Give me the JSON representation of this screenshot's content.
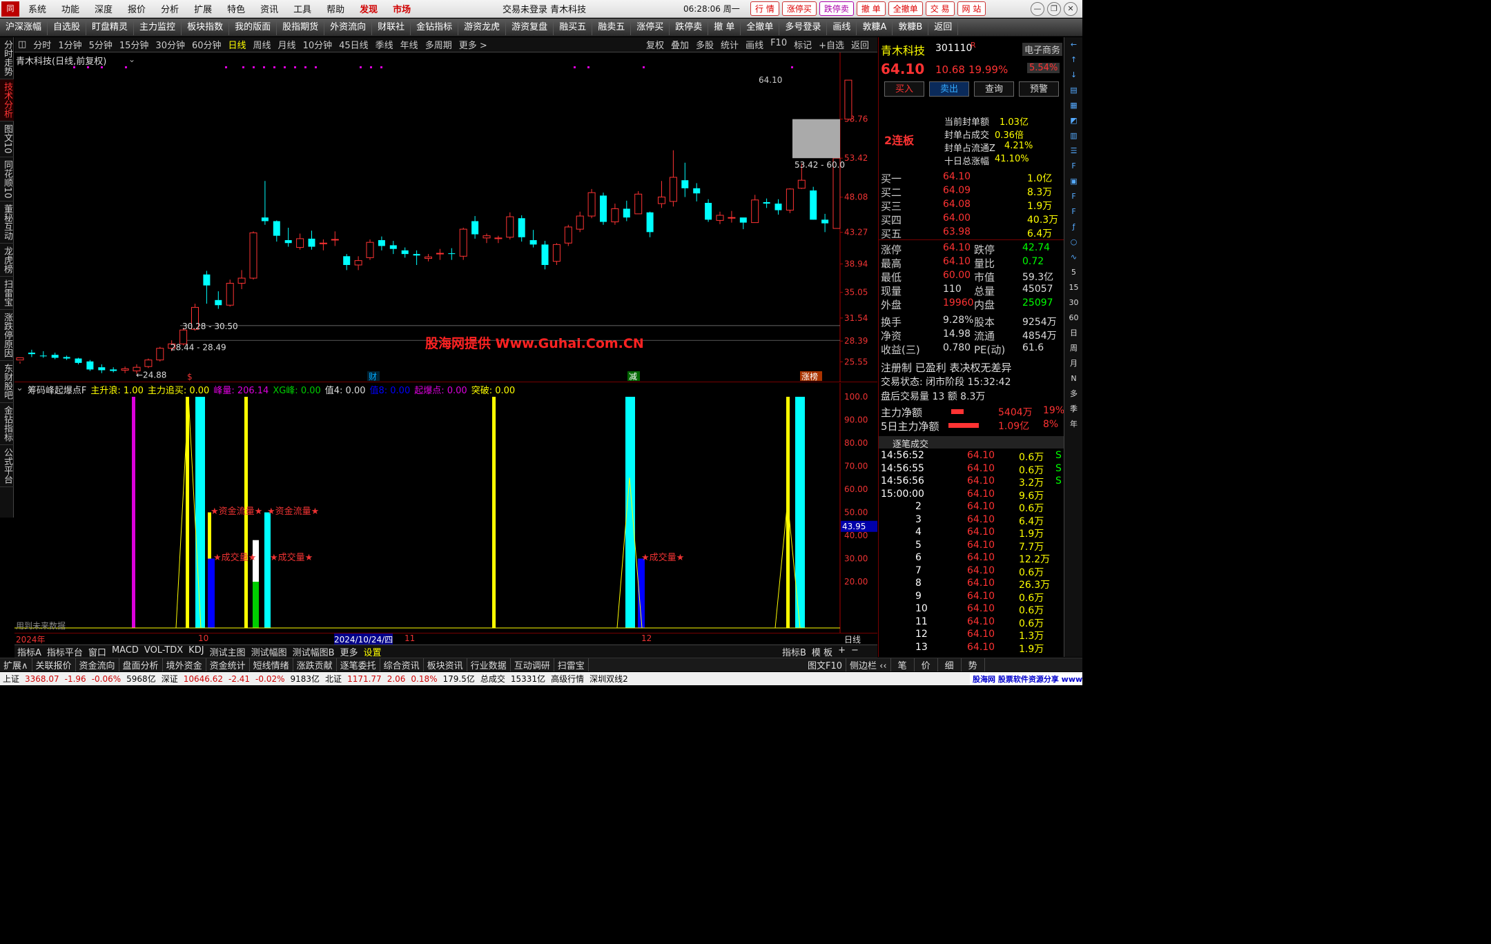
{
  "menu": {
    "items": [
      "系统",
      "功能",
      "深度",
      "报价",
      "分析",
      "扩展",
      "特色",
      "资讯",
      "工具",
      "帮助"
    ],
    "discover": "发现",
    "market": "市场",
    "center": "交易未登录  青木科技",
    "clock": "06:28:06 周一",
    "rbtns": [
      "行 情",
      "涨停买",
      "跌停卖",
      "撤 单",
      "全撤单",
      "交 易",
      "网 站"
    ]
  },
  "toolbar": [
    "沪深涨幅",
    "自选股",
    "盯盘精灵",
    "主力监控",
    "板块指数",
    "我的版面",
    "股指期货",
    "外资流向",
    "财联社",
    "金钻指标",
    "游资龙虎",
    "游资复盘",
    "融买五",
    "融卖五",
    "涨停买",
    "跌停卖",
    "撤 单",
    "全撤单",
    "多号登录",
    "画线",
    "敦糠A",
    "敦糠B",
    "返回"
  ],
  "lefttabs": [
    "分时走势",
    "技术分析",
    "图文10",
    "同花顺10",
    "董秘互动",
    "龙虎榜",
    "扫雷宝",
    "涨跌停原因",
    "东财股吧",
    "金钻指标",
    "公式平台"
  ],
  "periods": [
    "分时",
    "1分钟",
    "5分钟",
    "15分钟",
    "30分钟",
    "60分钟",
    "日线",
    "周线",
    "月线",
    "10分钟",
    "45日线",
    "季线",
    "年线",
    "多周期",
    "更多 >"
  ],
  "periods_right": [
    "复权",
    "叠加",
    "多股",
    "统计",
    "画线",
    "F10",
    "标记",
    "+自选",
    "返回"
  ],
  "chart_title": "青木科技(日线,前复权)",
  "price_axis": [
    "58.76",
    "53.42",
    "48.08",
    "43.27",
    "38.94",
    "35.05",
    "31.54",
    "28.39",
    "25.55"
  ],
  "chart_data": {
    "type": "candlestick",
    "ylim": [
      23.5,
      66
    ],
    "candles": [
      [
        25.8,
        26.1,
        25.3,
        25.6
      ],
      [
        26.8,
        26.6,
        27.2,
        26.2
      ],
      [
        26.4,
        26.3,
        27.0,
        26.1
      ],
      [
        26.5,
        26.1,
        26.8,
        25.9
      ],
      [
        26.2,
        26.0,
        26.4,
        25.8
      ],
      [
        26.0,
        25.4,
        26.1,
        25.2
      ],
      [
        25.6,
        24.5,
        25.8,
        24.3
      ],
      [
        24.8,
        24.4,
        25.2,
        24.0
      ],
      [
        24.5,
        24.3,
        24.8,
        24.1
      ],
      [
        24.4,
        24.6,
        24.9,
        24.0
      ],
      [
        24.3,
        24.8,
        25.2,
        23.9
      ],
      [
        24.9,
        25.8,
        26.0,
        24.7
      ],
      [
        25.8,
        27.4,
        27.6,
        25.6
      ],
      [
        27.4,
        28.0,
        28.49,
        27.0
      ],
      [
        28.0,
        29.9,
        30.2,
        27.8
      ],
      [
        30.0,
        33.0,
        33.5,
        29.8
      ],
      [
        37.5,
        36.0,
        38.0,
        33.5
      ],
      [
        34.0,
        33.3,
        35.2,
        32.8
      ],
      [
        33.3,
        36.3,
        36.8,
        33.1
      ],
      [
        36.3,
        37.0,
        38.1,
        35.5
      ],
      [
        37.0,
        43.2,
        43.4,
        36.8
      ],
      [
        45.3,
        44.8,
        50.3,
        44.3
      ],
      [
        44.8,
        42.8,
        44.9,
        42.0
      ],
      [
        42.2,
        41.8,
        43.9,
        41.3
      ],
      [
        41.2,
        42.4,
        43.1,
        40.9
      ],
      [
        42.4,
        41.3,
        43.5,
        40.9
      ],
      [
        41.7,
        41.8,
        42.3,
        40.8
      ],
      [
        42.3,
        42.3,
        43.4,
        41.4
      ],
      [
        40.0,
        38.8,
        40.3,
        38.1
      ],
      [
        38.8,
        39.4,
        40.0,
        38.1
      ],
      [
        39.8,
        41.9,
        42.3,
        39.5
      ],
      [
        42.2,
        41.4,
        42.7,
        40.8
      ],
      [
        41.5,
        41.0,
        42.1,
        40.3
      ],
      [
        40.8,
        40.3,
        41.2,
        39.8
      ],
      [
        40.3,
        40.1,
        40.8,
        38.8
      ],
      [
        39.7,
        39.9,
        40.3,
        39.3
      ],
      [
        40.4,
        40.4,
        41.0,
        39.5
      ],
      [
        40.4,
        40.3,
        41.1,
        39.5
      ],
      [
        40.0,
        43.7,
        43.9,
        39.5
      ],
      [
        44.8,
        43.0,
        45.5,
        42.4
      ],
      [
        42.5,
        42.8,
        43.1,
        41.8
      ],
      [
        42.4,
        42.5,
        42.8,
        41.8
      ],
      [
        42.6,
        45.4,
        46.0,
        42.3
      ],
      [
        45.2,
        42.6,
        45.6,
        42.0
      ],
      [
        42.2,
        41.6,
        43.6,
        41.2
      ],
      [
        41.6,
        38.8,
        42.1,
        38.2
      ],
      [
        39.3,
        41.6,
        41.8,
        38.8
      ],
      [
        41.8,
        44.0,
        44.3,
        41.4
      ],
      [
        43.7,
        45.5,
        46.1,
        43.3
      ],
      [
        45.5,
        48.7,
        49.2,
        45.2
      ],
      [
        48.3,
        44.7,
        48.7,
        44.3
      ],
      [
        44.7,
        46.5,
        47.2,
        44.3
      ],
      [
        46.5,
        45.3,
        47.6,
        44.8
      ],
      [
        45.8,
        48.5,
        48.9,
        45.8
      ],
      [
        46.0,
        43.3,
        46.1,
        42.6
      ],
      [
        47.2,
        48.1,
        50.3,
        46.6
      ],
      [
        47.5,
        50.8,
        54.5,
        46.8
      ],
      [
        50.4,
        49.3,
        52.8,
        48.1
      ],
      [
        49.3,
        48.6,
        50.0,
        47.5
      ],
      [
        47.3,
        45.0,
        47.8,
        44.7
      ],
      [
        44.9,
        45.6,
        46.1,
        44.4
      ],
      [
        45.3,
        45.3,
        46.2,
        44.6
      ],
      [
        45.3,
        44.6,
        45.2,
        43.7
      ],
      [
        44.6,
        47.7,
        48.4,
        44.6
      ],
      [
        47.4,
        47.2,
        47.9,
        46.6
      ],
      [
        47.2,
        46.3,
        47.8,
        45.7
      ],
      [
        46.3,
        49.2,
        49.3,
        45.9
      ],
      [
        49.3,
        50.4,
        52.7,
        49.2
      ],
      [
        49.0,
        45.0,
        49.5,
        45.0
      ],
      [
        45.0,
        44.5,
        45.8,
        43.3
      ],
      [
        43.8,
        53.42,
        53.42,
        43.8
      ],
      [
        58.76,
        64.1,
        64.1,
        58.76
      ]
    ]
  },
  "price_marks": [
    "64.10",
    "53.42 - 60.0",
    "30.28 - 30.50",
    "28.44 - 28.49",
    "24.88"
  ],
  "event_marks": [
    "$",
    "财",
    "减",
    "涨榜"
  ],
  "watermark": "股海网提供 Www.Guhai.Com.CN",
  "indicator_title": [
    "筹码峰起爆点F",
    "主升浪: 1.00",
    "主力追买: 0.00",
    "峰量: 206.14",
    "XG峰: 0.00",
    "值4: 0.00",
    "值8: 0.00",
    "起爆点: 0.00",
    "突破: 0.00"
  ],
  "sub_axis": [
    "100.0",
    "90.00",
    "80.00",
    "70.00",
    "60.00",
    "50.00",
    "40.00",
    "30.00",
    "20.00"
  ],
  "sub_current": "43.95",
  "sub_labels": [
    "★资金流量★",
    "★资金流量★",
    "★成交量★",
    "★成交量★",
    "★成交量★"
  ],
  "future_note": "用到未来数据",
  "date_axis": [
    "2024年",
    "10",
    "2024/10/24/四",
    "11",
    "12"
  ],
  "period_label": "日线",
  "indbar": [
    "指标A",
    "指标平台",
    "窗口",
    "MACD",
    "VOL-TDX",
    "KDJ",
    "测试主图",
    "测试幅图",
    "测试幅图B",
    "更多",
    "设置"
  ],
  "indbar_right": [
    "指标B",
    "模 板",
    "+",
    "−"
  ],
  "bottomtabs": [
    "扩展∧",
    "关联报价",
    "资金流向",
    "盘面分析",
    "境外资金",
    "资金统计",
    "短线情绪",
    "涨跌贡献",
    "逐笔委托",
    "综合资讯",
    "板块资讯",
    "行业数据",
    "互动调研",
    "扫雷宝"
  ],
  "bottom_right": [
    "图文F10",
    "侧边栏 ‹‹",
    "笔",
    "价",
    "细",
    "势"
  ],
  "status": [
    "上证",
    "3368.07",
    "-1.96",
    "-0.06%",
    "5968亿",
    "深证",
    "10646.62",
    "-2.41",
    "-0.02%",
    "9183亿",
    "北证",
    "1171.77",
    "2.06",
    "0.18%",
    "179.5亿",
    "总成交",
    "15331亿",
    "高级行情",
    "深圳双线2"
  ],
  "stock": {
    "name": "青木科技",
    "code": "301110",
    "flag": "R",
    "sector": "电子商务",
    "price": "64.10",
    "change": "10.68",
    "pct": "19.99%",
    "amp": "5.54%",
    "buttons": [
      "买入",
      "卖出",
      "查询",
      "预警"
    ],
    "lianban": "2连板",
    "seal": [
      [
        "当前封单额",
        "1.03亿"
      ],
      [
        "封单占成交",
        "0.36倍"
      ],
      [
        "封单占流通Z",
        "4.21%"
      ],
      [
        "十日总涨幅",
        "41.10%"
      ]
    ],
    "orders": [
      [
        "买一",
        "64.10",
        "1.0亿"
      ],
      [
        "买二",
        "64.09",
        "8.3万"
      ],
      [
        "买三",
        "64.08",
        "1.9万"
      ],
      [
        "买四",
        "64.00",
        "40.3万"
      ],
      [
        "买五",
        "63.98",
        "6.4万"
      ]
    ],
    "stats": [
      [
        "涨停",
        "64.10",
        "跌停",
        "42.74"
      ],
      [
        "最高",
        "64.10",
        "量比",
        "0.72"
      ],
      [
        "最低",
        "60.00",
        "市值",
        "59.3亿"
      ],
      [
        "现量",
        "110",
        "总量",
        "45057"
      ],
      [
        "外盘",
        "19960",
        "内盘",
        "25097"
      ]
    ],
    "stats2": [
      [
        "换手",
        "9.28%",
        "股本",
        "9254万"
      ],
      [
        "净资",
        "14.98",
        "流通",
        "4854万"
      ],
      [
        "收益(三)",
        "0.780",
        "PE(动)",
        "61.6"
      ]
    ],
    "info": [
      "注册制 已盈利 表决权无差异",
      "交易状态: 闭市阶段 15:32:42",
      "盘后交易量 13 额 8.3万"
    ],
    "flow": [
      [
        "主力净额",
        "5404万",
        "19%"
      ],
      [
        "5日主力净额",
        "1.09亿",
        "8%"
      ]
    ],
    "ticks_title": "逐笔成交",
    "ticks": [
      [
        "14:56:52",
        "64.10",
        "0.6万",
        "S"
      ],
      [
        "14:56:55",
        "64.10",
        "0.6万",
        "S"
      ],
      [
        "14:56:56",
        "64.10",
        "3.2万",
        "S"
      ],
      [
        "15:00:00",
        "64.10",
        "9.6万",
        ""
      ],
      [
        "2",
        "64.10",
        "0.6万",
        ""
      ],
      [
        "3",
        "64.10",
        "6.4万",
        ""
      ],
      [
        "4",
        "64.10",
        "1.9万",
        ""
      ],
      [
        "5",
        "64.10",
        "7.7万",
        ""
      ],
      [
        "6",
        "64.10",
        "12.2万",
        ""
      ],
      [
        "7",
        "64.10",
        "0.6万",
        ""
      ],
      [
        "8",
        "64.10",
        "26.3万",
        ""
      ],
      [
        "9",
        "64.10",
        "0.6万",
        ""
      ],
      [
        "10",
        "64.10",
        "0.6万",
        ""
      ],
      [
        "11",
        "64.10",
        "0.6万",
        ""
      ],
      [
        "12",
        "64.10",
        "1.3万",
        ""
      ],
      [
        "13",
        "64.10",
        "1.9万",
        ""
      ]
    ]
  },
  "rightbar": [
    "5",
    "15",
    "30",
    "60",
    "日",
    "周",
    "月",
    "N",
    "多",
    "季",
    "年"
  ],
  "brand": "股海网 股票软件资源分享 www.Guhai.Com.cn",
  "colors": {
    "up": "#ff3333",
    "down": "#00ffff",
    "bg": "#000000"
  }
}
